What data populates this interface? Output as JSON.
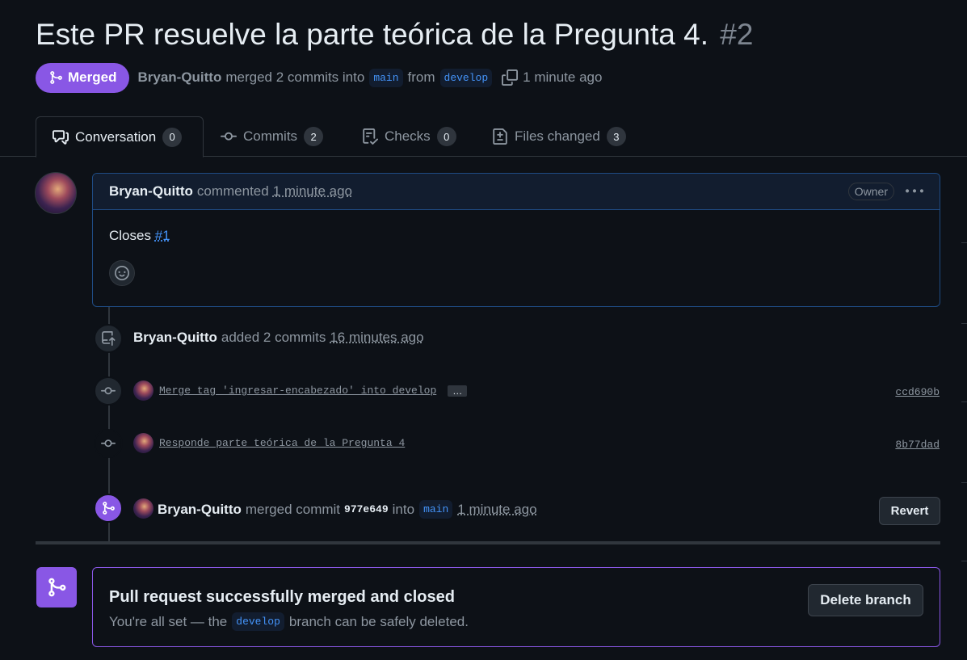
{
  "pr": {
    "title": "Este PR resuelve la parte teórica de la Pregunta 4.",
    "number": "#2",
    "state": "Merged",
    "author": "Bryan-Quitto",
    "merge_text": "merged 2 commits into",
    "base_branch": "main",
    "from_text": "from",
    "head_branch": "develop",
    "time": "1 minute ago"
  },
  "tabs": [
    {
      "label": "Conversation",
      "count": "0",
      "icon": "comment-discussion-icon"
    },
    {
      "label": "Commits",
      "count": "2",
      "icon": "git-commit-icon"
    },
    {
      "label": "Checks",
      "count": "0",
      "icon": "checklist-icon"
    },
    {
      "label": "Files changed",
      "count": "3",
      "icon": "file-diff-icon"
    }
  ],
  "comment": {
    "author": "Bryan-Quitto",
    "action": "commented",
    "time": "1 minute ago",
    "badge": "Owner",
    "body_prefix": "Closes",
    "body_link": "#1"
  },
  "timeline": {
    "added": {
      "author": "Bryan-Quitto",
      "text": "added 2 commits",
      "time": "16 minutes ago"
    },
    "commits": [
      {
        "message": "Merge tag 'ingresar-encabezado' into develop",
        "sha": "ccd690b",
        "has_more": true,
        "more_label": "…"
      },
      {
        "message": "Responde parte teórica de la Pregunta 4",
        "sha": "8b77dad",
        "has_more": false
      }
    ],
    "merged": {
      "author": "Bryan-Quitto",
      "text": "merged commit",
      "sha": "977e649",
      "into": "into",
      "branch": "main",
      "time": "1 minute ago",
      "revert_label": "Revert"
    }
  },
  "merge_box": {
    "title": "Pull request successfully merged and closed",
    "sub_prefix": "You're all set — the",
    "branch": "develop",
    "sub_suffix": "branch can be safely deleted.",
    "delete_label": "Delete branch"
  },
  "colors": {
    "background": "#0d1117",
    "merged_purple": "#8957e5",
    "link_blue": "#4493f8",
    "muted": "#8d96a0"
  }
}
